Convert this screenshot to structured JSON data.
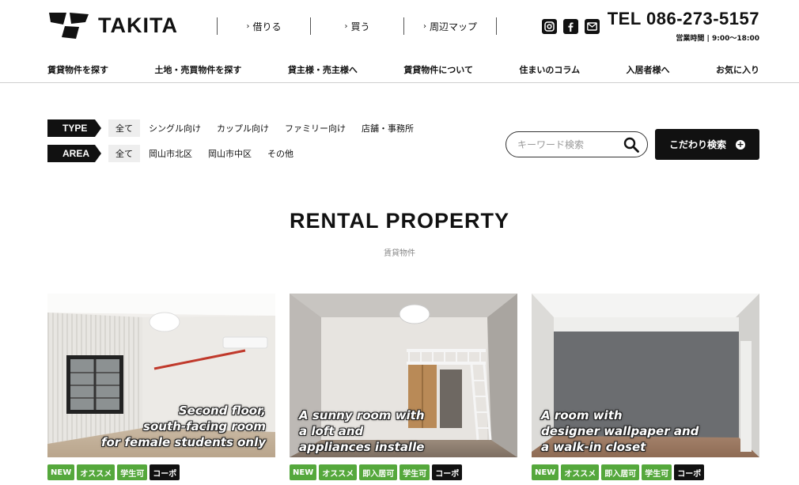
{
  "brand": {
    "name": "TAKITA"
  },
  "topnav": [
    {
      "label": "借りる"
    },
    {
      "label": "買う"
    },
    {
      "label": "周辺マップ"
    }
  ],
  "social": [
    {
      "icon": "instagram-icon"
    },
    {
      "icon": "facebook-icon"
    },
    {
      "icon": "mail-icon"
    }
  ],
  "contact": {
    "tel": "TEL 086-273-5157",
    "hours": "営業時間 | 9:00〜18:00"
  },
  "mainnav": [
    {
      "label": "賃貸物件を探す"
    },
    {
      "label": "土地・売買物件を探す"
    },
    {
      "label": "貸主様・売主様へ"
    },
    {
      "label": "賃貸物件について"
    },
    {
      "label": "住まいのコラム"
    },
    {
      "label": "入居者様へ"
    },
    {
      "label": "お気に入り"
    }
  ],
  "filters": {
    "type": {
      "label": "TYPE",
      "options": [
        "全て",
        "シングル向け",
        "カップル向け",
        "ファミリー向け",
        "店舗・事務所"
      ],
      "selected": "全て"
    },
    "area": {
      "label": "AREA",
      "options": [
        "全て",
        "岡山市北区",
        "岡山市中区",
        "その他"
      ],
      "selected": "全て"
    }
  },
  "search": {
    "placeholder": "キーワード検索",
    "value": ""
  },
  "advanced_search": {
    "label": "こだわり検索"
  },
  "section": {
    "title": "RENTAL PROPERTY",
    "subtitle": "賃貸物件"
  },
  "properties": [
    {
      "caption": "Second floor,\nsouth-facing room\nfor female students only",
      "tags": [
        {
          "label": "NEW",
          "style": "green"
        },
        {
          "label": "オススメ",
          "style": "green"
        },
        {
          "label": "学生可",
          "style": "green"
        },
        {
          "label": "コーポ",
          "style": "black"
        }
      ]
    },
    {
      "caption": "A sunny room with\na loft and\nappliances installe",
      "tags": [
        {
          "label": "NEW",
          "style": "green"
        },
        {
          "label": "オススメ",
          "style": "green"
        },
        {
          "label": "即入居可",
          "style": "green"
        },
        {
          "label": "学生可",
          "style": "green"
        },
        {
          "label": "コーポ",
          "style": "black"
        }
      ]
    },
    {
      "caption": "A room with\ndesigner wallpaper and\na walk-in closet",
      "tags": [
        {
          "label": "NEW",
          "style": "green"
        },
        {
          "label": "オススメ",
          "style": "green"
        },
        {
          "label": "即入居可",
          "style": "green"
        },
        {
          "label": "学生可",
          "style": "green"
        },
        {
          "label": "コーポ",
          "style": "black"
        }
      ]
    }
  ],
  "colors": {
    "accent_green": "#55a83c",
    "dark": "#111111"
  }
}
